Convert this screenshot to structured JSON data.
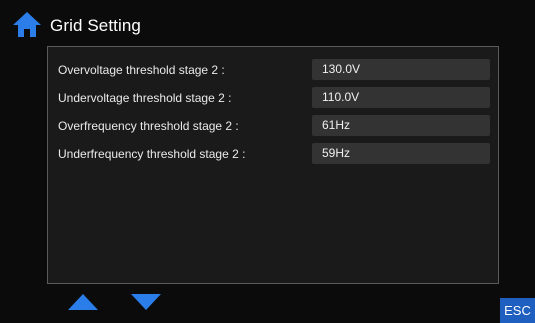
{
  "header": {
    "title": "Grid Setting",
    "home_icon": "home-icon"
  },
  "settings": [
    {
      "label": "Overvoltage threshold stage 2 :",
      "value": "130.0V"
    },
    {
      "label": "Undervoltage threshold stage 2 :",
      "value": "110.0V"
    },
    {
      "label": "Overfrequency threshold stage 2 :",
      "value": "61Hz"
    },
    {
      "label": "Underfrequency threshold stage 2 :",
      "value": "59Hz"
    }
  ],
  "footer": {
    "up_icon": "triangle-up-icon",
    "down_icon": "triangle-down-icon",
    "esc_label": "ESC"
  },
  "colors": {
    "accent": "#2b7de9",
    "esc_background": "#1f5fbf",
    "background": "#0b0b0b",
    "panel": "#1a1a1a",
    "field": "#333333"
  }
}
